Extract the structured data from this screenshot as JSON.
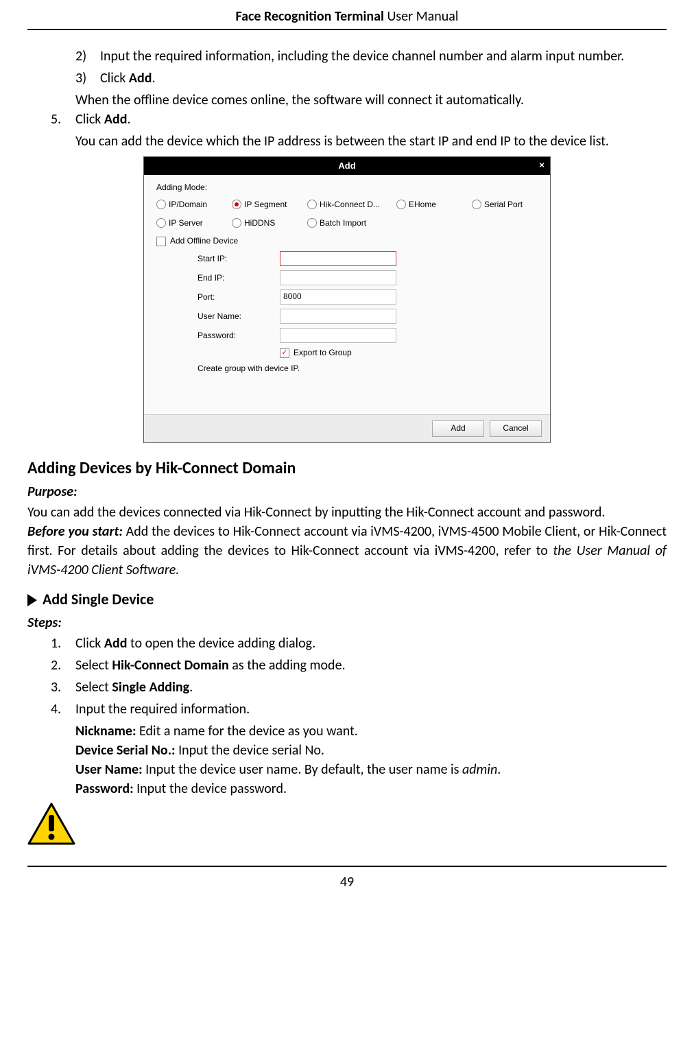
{
  "header": {
    "bold": "Face Recognition Terminal",
    "rest": "  User Manual"
  },
  "page_number": "49",
  "top": {
    "step2_num": "2)",
    "step2_text": "Input the required information, including the device channel number and alarm input number.",
    "step3_num": "3)",
    "step3_pre": "Click ",
    "step3_bold": "Add",
    "step3_post": ".",
    "step3_note": "When the offline device comes online, the software will connect it automatically.",
    "step5_num": "5.",
    "step5_pre": "Click ",
    "step5_bold": "Add",
    "step5_post": ".",
    "step5_note": "You can add the device which the IP address is between the start IP and end IP to the device list."
  },
  "dialog": {
    "title": "Add",
    "close": "×",
    "mode_label": "Adding Mode:",
    "radios": {
      "ip_domain": "IP/Domain",
      "ip_segment": "IP Segment",
      "hik_connect_d": "Hik-Connect D...",
      "ehome": "EHome",
      "serial_port": "Serial Port",
      "ip_server": "IP Server",
      "hiddns": "HiDDNS",
      "batch_import": "Batch Import"
    },
    "offline_label": "Add Offline Device",
    "fields": {
      "start_ip": "Start IP:",
      "end_ip": "End IP:",
      "port": "Port:",
      "port_value": "8000",
      "user_name": "User Name:",
      "password": "Password:"
    },
    "export_label": "Export to Group",
    "hint": "Create group with device IP.",
    "btn_add": "Add",
    "btn_cancel": "Cancel"
  },
  "section2": {
    "heading": "Adding Devices by Hik-Connect Domain",
    "purpose_label": "Purpose:",
    "purpose_text": "You can add the devices connected via Hik-Connect by inputting the Hik-Connect account and password.",
    "before_bold": "Before you start:",
    "before_text_1": " Add the devices to Hik-Connect account via iVMS-4200, iVMS-4500 Mobile Client, or Hik-Connect first. For details about adding the devices to Hik-Connect account via iVMS-4200, refer to ",
    "before_italic": "the User Manual of iVMS-4200 Client Software."
  },
  "section3": {
    "heading": "Add Single Device",
    "steps_label": "Steps:",
    "s1_num": "1.",
    "s1_pre": "Click ",
    "s1_bold": "Add",
    "s1_post": " to open the device adding dialog.",
    "s2_num": "2.",
    "s2_pre": "Select ",
    "s2_bold": "Hik-Connect Domain",
    "s2_post": " as the adding mode.",
    "s3_num": "3.",
    "s3_pre": "Select ",
    "s3_bold": "Single Adding",
    "s3_post": ".",
    "s4_num": "4.",
    "s4_text": "Input the required information.",
    "f1_bold": "Nickname:",
    "f1_text": " Edit a name for the device as you want.",
    "f2_bold": "Device Serial No.:",
    "f2_text": " Input the device serial No.",
    "f3_bold": "User Name:",
    "f3_text_pre": " Input the device user name. By default, the user name is ",
    "f3_italic": "admin",
    "f3_text_post": ".",
    "f4_bold": "Password:",
    "f4_text": " Input the device password."
  }
}
